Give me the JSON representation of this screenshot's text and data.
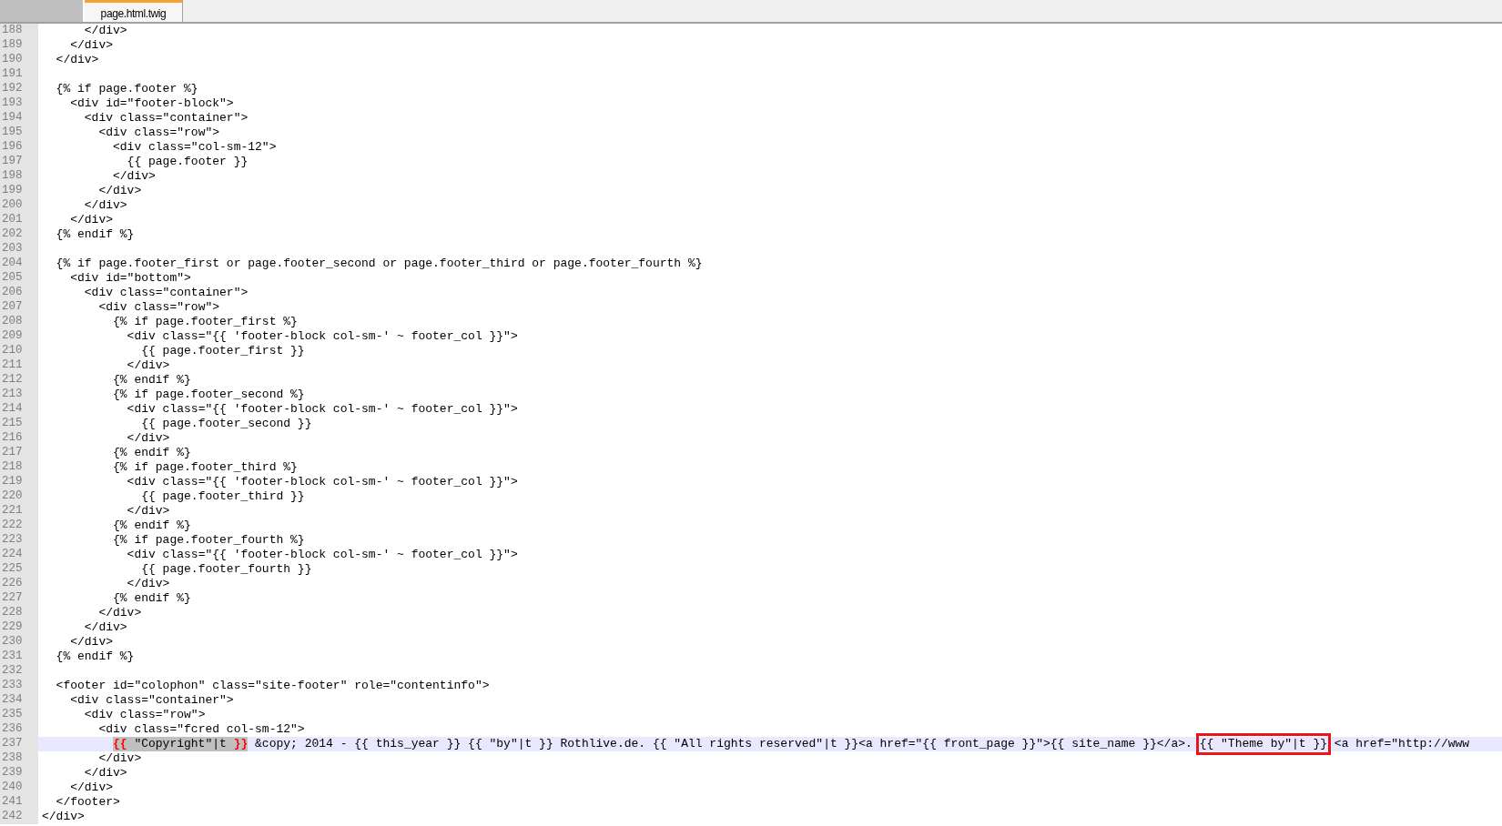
{
  "tabs": [
    {
      "label": "page.html.twig",
      "selected": true
    }
  ],
  "lines": [
    {
      "number": "188",
      "current": false,
      "code": "      </div>"
    },
    {
      "number": "189",
      "current": false,
      "code": "    </div>"
    },
    {
      "number": "190",
      "current": false,
      "code": "  </div>"
    },
    {
      "number": "191",
      "current": false
    },
    {
      "number": "192",
      "current": false,
      "code": "  {% if page.footer %}"
    },
    {
      "number": "193",
      "current": false,
      "code": "    <div id=\"footer-block\">"
    },
    {
      "number": "194",
      "current": false,
      "code": "      <div class=\"container\">"
    },
    {
      "number": "195",
      "current": false,
      "code": "        <div class=\"row\">"
    },
    {
      "number": "196",
      "current": false,
      "code": "          <div class=\"col-sm-12\">"
    },
    {
      "number": "197",
      "current": false,
      "code": "            {{ page.footer }}"
    },
    {
      "number": "198",
      "current": false,
      "code": "          </div>"
    },
    {
      "number": "199",
      "current": false,
      "code": "        </div>"
    },
    {
      "number": "200",
      "current": false,
      "code": "      </div>"
    },
    {
      "number": "201",
      "current": false,
      "code": "    </div>"
    },
    {
      "number": "202",
      "current": false,
      "code": "  {% endif %}"
    },
    {
      "number": "203",
      "current": false
    },
    {
      "number": "204",
      "current": false,
      "code": "  {% if page.footer_first or page.footer_second or page.footer_third or page.footer_fourth %}"
    },
    {
      "number": "205",
      "current": false,
      "code": "    <div id=\"bottom\">"
    },
    {
      "number": "206",
      "current": false,
      "code": "      <div class=\"container\">"
    },
    {
      "number": "207",
      "current": false,
      "code": "        <div class=\"row\">"
    },
    {
      "number": "208",
      "current": false,
      "code": "          {% if page.footer_first %}"
    },
    {
      "number": "209",
      "current": false,
      "code": "            <div class=\"{{ 'footer-block col-sm-' ~ footer_col }}\">"
    },
    {
      "number": "210",
      "current": false,
      "code": "              {{ page.footer_first }}"
    },
    {
      "number": "211",
      "current": false,
      "code": "            </div>"
    },
    {
      "number": "212",
      "current": false,
      "code": "          {% endif %}"
    },
    {
      "number": "213",
      "current": false,
      "code": "          {% if page.footer_second %}"
    },
    {
      "number": "214",
      "current": false,
      "code": "            <div class=\"{{ 'footer-block col-sm-' ~ footer_col }}\">"
    },
    {
      "number": "215",
      "current": false,
      "code": "              {{ page.footer_second }}"
    },
    {
      "number": "216",
      "current": false,
      "code": "            </div>"
    },
    {
      "number": "217",
      "current": false,
      "code": "          {% endif %}"
    },
    {
      "number": "218",
      "current": false,
      "code": "          {% if page.footer_third %}"
    },
    {
      "number": "219",
      "current": false,
      "code": "            <div class=\"{{ 'footer-block col-sm-' ~ footer_col }}\">"
    },
    {
      "number": "220",
      "current": false,
      "code": "              {{ page.footer_third }}"
    },
    {
      "number": "221",
      "current": false,
      "code": "            </div>"
    },
    {
      "number": "222",
      "current": false,
      "code": "          {% endif %}"
    },
    {
      "number": "223",
      "current": false,
      "code": "          {% if page.footer_fourth %}"
    },
    {
      "number": "224",
      "current": false,
      "code": "            <div class=\"{{ 'footer-block col-sm-' ~ footer_col }}\">"
    },
    {
      "number": "225",
      "current": false,
      "code": "              {{ page.footer_fourth }}"
    },
    {
      "number": "226",
      "current": false,
      "code": "            </div>"
    },
    {
      "number": "227",
      "current": false,
      "code": "          {% endif %}"
    },
    {
      "number": "228",
      "current": false,
      "code": "        </div>"
    },
    {
      "number": "229",
      "current": false,
      "code": "      </div>"
    },
    {
      "number": "230",
      "current": false,
      "code": "    </div>"
    },
    {
      "number": "231",
      "current": false,
      "code": "  {% endif %}"
    },
    {
      "number": "232",
      "current": false
    },
    {
      "number": "233",
      "current": false,
      "code": "  <footer id=\"colophon\" class=\"site-footer\" role=\"contentinfo\">"
    },
    {
      "number": "234",
      "current": false,
      "code": "    <div class=\"container\">"
    },
    {
      "number": "235",
      "current": false,
      "code": "      <div class=\"row\">"
    },
    {
      "number": "236",
      "current": false,
      "code": "        <div class=\"fcred col-sm-12\">"
    },
    {
      "number": "237",
      "current": true,
      "segments": [
        {
          "kind": "brace_match",
          "text": "{{"
        },
        {
          "kind": "selected",
          "text": " \"Copyright\"|t "
        },
        {
          "kind": "brace_match",
          "text": "}}"
        },
        {
          "kind": "plain",
          "text": " &copy; 2014 - {{ this_year }} {{ \"by\"|t }} Rothlive.de. {{ \"All rights reserved\"|t }}<a href=\"{{ front_page }}\">{{ site_name }}</a>. "
        },
        {
          "kind": "boxed",
          "text": "{{ \"Theme by\"|t }}"
        },
        {
          "kind": "plain",
          "text": " <a href=\"http://www"
        }
      ]
    },
    {
      "number": "238",
      "current": false,
      "code": "        </div>"
    },
    {
      "number": "239",
      "current": false,
      "code": "      </div>"
    },
    {
      "number": "240",
      "current": false,
      "code": "    </div>"
    },
    {
      "number": "241",
      "current": false,
      "code": "  </footer>"
    },
    {
      "number": "242",
      "current": false,
      "code": "</div>"
    }
  ]
}
